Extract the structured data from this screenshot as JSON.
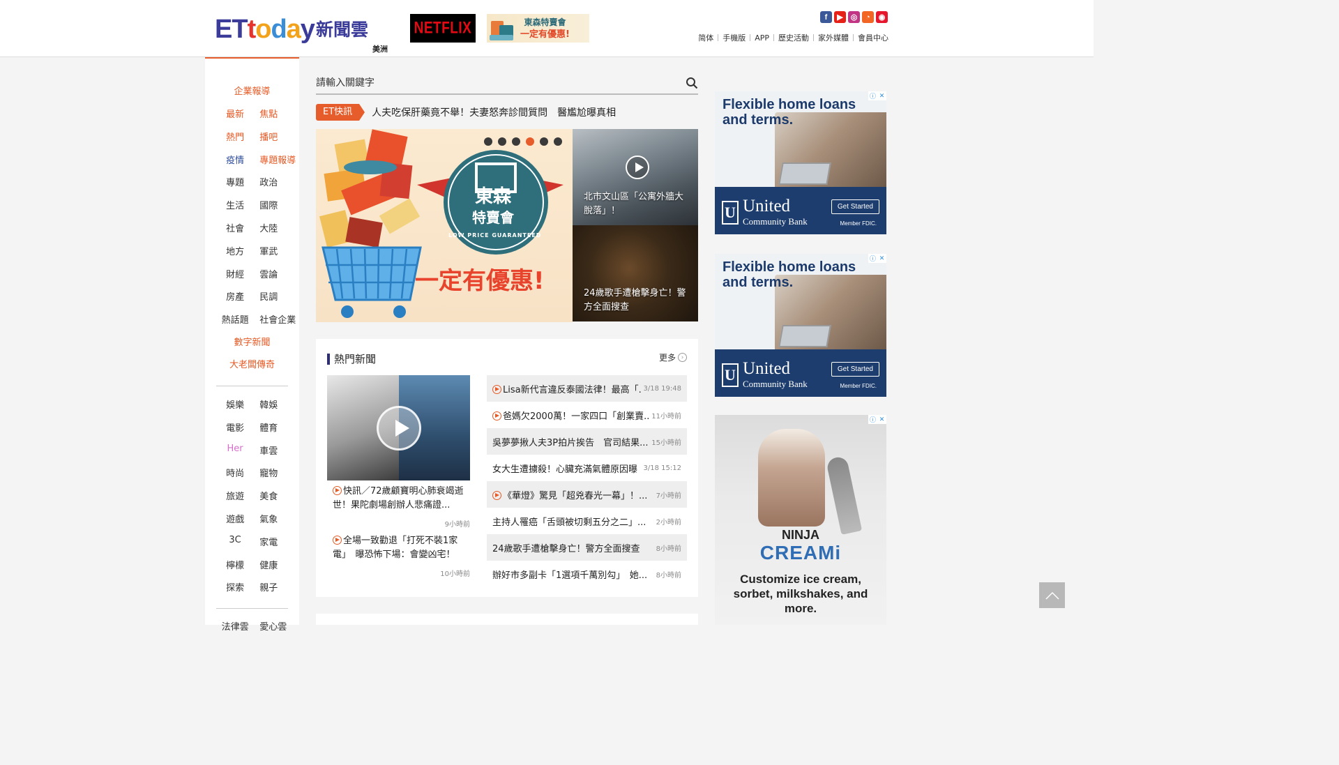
{
  "header": {
    "logo_latin": "ETtoday",
    "logo_cn": "新聞雲",
    "region": "美洲",
    "netflix_label": "NETFLIX",
    "sale_banner": {
      "line1": "東森特賣會",
      "line2": "一定有優惠!"
    },
    "socials": [
      {
        "icon": "facebook-icon",
        "glyph": "f",
        "color": "#3b5998"
      },
      {
        "icon": "youtube-icon",
        "glyph": "▶",
        "color": "#e62117"
      },
      {
        "icon": "instagram-icon",
        "glyph": "◎",
        "color": "#c13584"
      },
      {
        "icon": "rss-icon",
        "glyph": "◔",
        "color": "#f26522"
      },
      {
        "icon": "weibo-icon",
        "glyph": "◉",
        "color": "#e6162d"
      }
    ],
    "top_links": [
      "简体",
      "手機版",
      "APP",
      "歷史活動",
      "家外媒體",
      "會員中心"
    ]
  },
  "leftnav": {
    "featured": "企業報導",
    "rows": [
      [
        "最新",
        "焦點"
      ],
      [
        "熱門",
        "播吧"
      ],
      [
        "疫情",
        "專題報導"
      ],
      [
        "專題",
        "政治"
      ],
      [
        "生活",
        "國際"
      ],
      [
        "社會",
        "大陸"
      ],
      [
        "地方",
        "軍武"
      ],
      [
        "財經",
        "雲論"
      ],
      [
        "房產",
        "民調"
      ],
      [
        "熱話題",
        "社會企業"
      ]
    ],
    "singles": [
      "數字新聞",
      "大老闆傳奇"
    ],
    "rows2": [
      [
        "娛樂",
        "韓娛"
      ],
      [
        "電影",
        "體育"
      ],
      [
        "Her",
        "車雲"
      ],
      [
        "時尚",
        "寵物"
      ],
      [
        "旅遊",
        "美食"
      ],
      [
        "遊戲",
        "氣象"
      ],
      [
        "3C",
        "家電"
      ],
      [
        "檸檬",
        "健康"
      ],
      [
        "探索",
        "親子"
      ]
    ],
    "rows3": [
      [
        "法律雲",
        "愛心雲"
      ]
    ]
  },
  "search": {
    "placeholder": "請輸入關鍵字"
  },
  "flash": {
    "tag": "ET快訊",
    "text": "人夫吃保肝藥竟不舉！夫妻怒奔診間質問　醫尷尬曝真相"
  },
  "hero": {
    "banner_line1": "東森",
    "banner_line2": "特賣會",
    "banner_sub": "LOW PRICE GUARANTEED",
    "banner_cta": "一定有優惠!",
    "carousel_active_index": 3,
    "side_cards": [
      {
        "caption": "北市文山區「公寓外牆大脫落」！"
      },
      {
        "caption": "24歲歌手遭槍擊身亡！警方全面搜查"
      }
    ]
  },
  "hot_news": {
    "title": "熱門新聞",
    "more": "更多",
    "left_stories": [
      {
        "title": "快訊／72歲顧寶明心肺衰竭逝世！果陀劇場創辦人悲痛證...",
        "time": "9小時前",
        "video": true
      },
      {
        "title": "全場一致勸退「打死不裝1家電」　曝恐怖下場：會變凶宅！",
        "time": "10小時前",
        "video": true
      }
    ],
    "list": [
      {
        "title": "Lisa新代言違反泰國法律！最高「...",
        "time": "3/18 19:48",
        "video": true
      },
      {
        "title": "爸媽欠2000萬！一家四口「創業賣...",
        "time": "11小時前",
        "video": true
      },
      {
        "title": "吳夢夢揪人夫3P拍片挨告　官司結果...",
        "time": "15小時前",
        "video": false
      },
      {
        "title": "女大生遭擄殺！心臟充滿氣體原因曝",
        "time": "3/18 15:12",
        "video": false
      },
      {
        "title": "《華燈》驚見「超兇春光一幕」！...",
        "time": "7小時前",
        "video": true
      },
      {
        "title": "主持人罹癌「舌頭被切剩五分之二」...",
        "time": "2小時前",
        "video": false
      },
      {
        "title": "24歲歌手遭槍擊身亡！警方全面搜查",
        "time": "8小時前",
        "video": false
      },
      {
        "title": "辦好市多副卡「1選項千萬別勾」　她...",
        "time": "8小時前",
        "video": false
      }
    ]
  },
  "ads": {
    "ucb": {
      "headline": "Flexible home loans and terms.",
      "bank_line1": "United",
      "bank_line2": "Community Bank",
      "cta": "Get Started",
      "fdic": "Member FDIC."
    },
    "ninja": {
      "brand1": "NINJA",
      "brand2": "CREAMi",
      "tagline": "Customize ice cream, sorbet, milkshakes, and more."
    }
  }
}
